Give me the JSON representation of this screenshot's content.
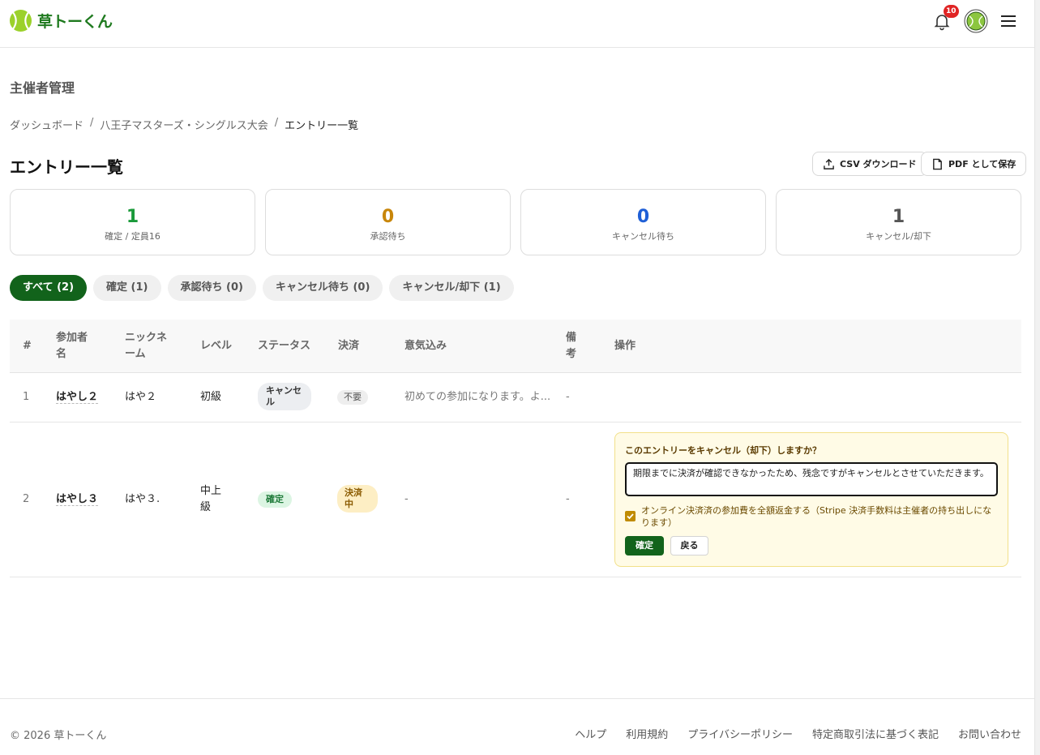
{
  "app": {
    "name": "草トーくん"
  },
  "header": {
    "notification_count": "10"
  },
  "section_title": "主催者管理",
  "breadcrumb": {
    "items": [
      "ダッシュボード",
      "八王子マスターズ・シングルス大会",
      "エントリー一覧"
    ],
    "separator": "/"
  },
  "page_title": "エントリー一覧",
  "actions": {
    "csv_label": "CSV ダウンロード",
    "pdf_label": "PDF として保存"
  },
  "stats": [
    {
      "value": "1",
      "label": "確定 / 定員16",
      "color": "#1a9a3a"
    },
    {
      "value": "0",
      "label": "承認待ち",
      "color": "#c8860a"
    },
    {
      "value": "0",
      "label": "キャンセル待ち",
      "color": "#1f5fd6"
    },
    {
      "value": "1",
      "label": "キャンセル/却下",
      "color": "#555555"
    }
  ],
  "tabs": [
    {
      "label": "すべて (2)",
      "active": true
    },
    {
      "label": "確定 (1)"
    },
    {
      "label": "承認待ち (0)"
    },
    {
      "label": "キャンセル待ち (0)"
    },
    {
      "label": "キャンセル/却下 (1)"
    }
  ],
  "table": {
    "headers": {
      "num": "#",
      "participant": "参加者名",
      "nickname": "ニックネーム",
      "level": "レベル",
      "status": "ステータス",
      "payment": "決済",
      "motivation": "意気込み",
      "notes": "備考",
      "actions": "操作"
    },
    "rows": [
      {
        "num": "1",
        "participant": "はやし２",
        "nickname": "はや２",
        "level": "初級",
        "status": "キャンセル",
        "payment": "不要",
        "motivation": "初めての参加になります。よ...",
        "notes": "-"
      },
      {
        "num": "2",
        "participant": "はやし３",
        "nickname": "はや３.",
        "level": "中上級",
        "status": "確定",
        "payment": "決済中",
        "motivation": "-",
        "notes": "-"
      }
    ]
  },
  "cancel_dialog": {
    "question": "このエントリーをキャンセル（却下）しますか？",
    "message": "期限までに決済が確認できなかったため、残念ですがキャンセルとさせていただきます。",
    "refund_label": "オンライン決済済の参加費を全額返金する（Stripe 決済手数料は主催者の持ち出しになります）",
    "refund_checked": true,
    "confirm_label": "確定",
    "back_label": "戻る"
  },
  "footer": {
    "copyright": "© 2026 草トーくん",
    "links": [
      "ヘルプ",
      "利用規約",
      "プライバシーポリシー",
      "特定商取引法に基づく表記",
      "お問い合わせ"
    ]
  }
}
